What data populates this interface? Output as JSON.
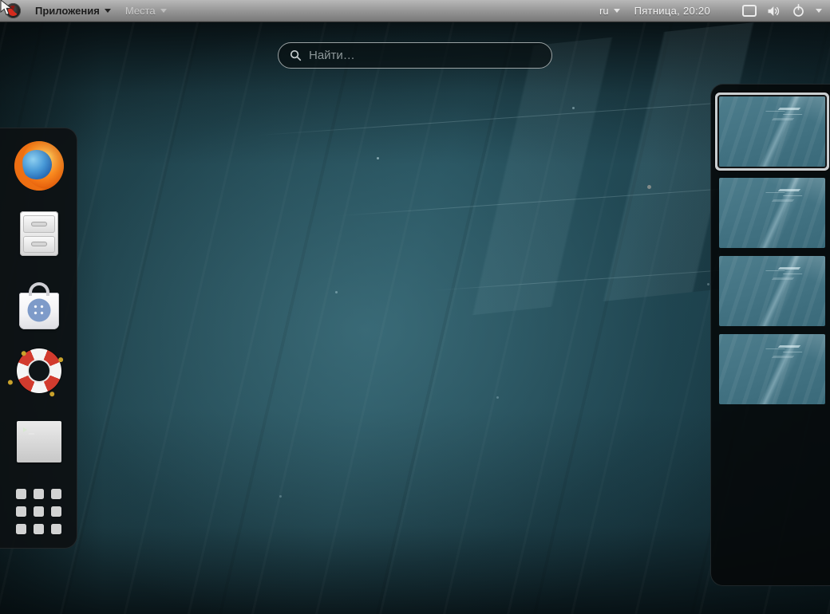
{
  "topbar": {
    "applications_label": "Приложения",
    "places_label": "Места",
    "keyboard_layout": "ru",
    "clock": "Пятница, 20:20",
    "status_icons": [
      "screen-icon",
      "volume-icon",
      "power-icon",
      "chevron-down-icon"
    ]
  },
  "search": {
    "placeholder": "Найти…"
  },
  "dash": {
    "items": [
      {
        "icon": "firefox-icon"
      },
      {
        "icon": "files-icon"
      },
      {
        "icon": "software-icon"
      },
      {
        "icon": "help-icon"
      },
      {
        "icon": "terminal-icon"
      },
      {
        "icon": "show-applications-icon"
      }
    ]
  },
  "workspaces": {
    "count": 4,
    "active_index": 0
  },
  "colors": {
    "topbar_bg": "#8f8f8f",
    "wallpaper_teal": "#27525e",
    "panel_bg": "#080b0c",
    "selection_border": "#caced0",
    "thumb_teal": "#447484",
    "software_badge_blue": "#7e9bc9",
    "lifebuoy_red": "#d23b2e"
  }
}
